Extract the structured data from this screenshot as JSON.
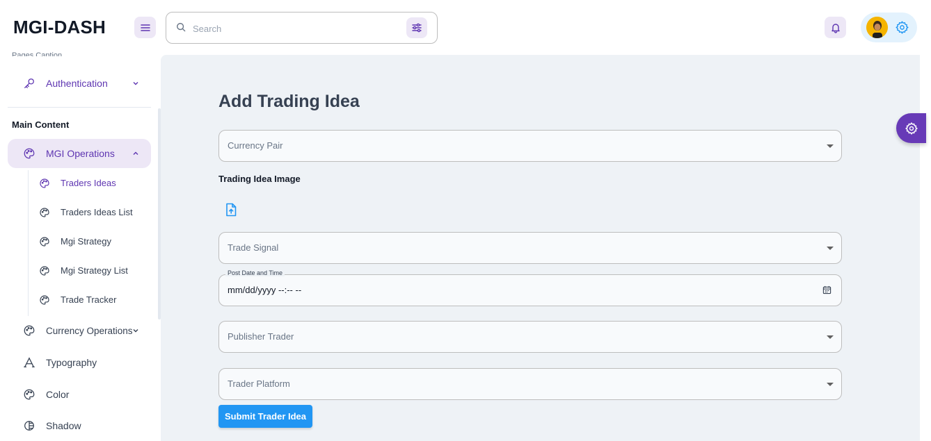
{
  "header": {
    "logo": "MGI-DASH",
    "search_placeholder": "Search",
    "icons": [
      "menu-icon",
      "search-icon",
      "filter-icon",
      "bell-icon",
      "gear-icon"
    ]
  },
  "sidebar": {
    "caption_cut": "Pages Caption",
    "authentication": "Authentication",
    "section_title": "Main Content",
    "mgi_operations": "MGI Operations",
    "sub_items": [
      "Traders Ideas",
      "Traders Ideas List",
      "Mgi Strategy",
      "Mgi Strategy List",
      "Trade Tracker"
    ],
    "currency_operations": "Currency Operations",
    "typography": "Typography",
    "color": "Color",
    "shadow": "Shadow"
  },
  "form": {
    "title": "Add Trading Idea",
    "currency_pair": "Currency Pair",
    "image_label": "Trading Idea Image",
    "trade_signal": "Trade Signal",
    "date_label": "Post Date and Time",
    "date_value": "mm/dd/yyyy --:-- --",
    "publisher_trader": "Publisher Trader",
    "trader_platform": "Trader Platform",
    "submit": "Submit Trader Idea"
  },
  "colors": {
    "primary_purple": "#5e35b1",
    "light_purple": "#ede7f6",
    "blue": "#2196f3",
    "main_bg": "#eef2f6"
  }
}
